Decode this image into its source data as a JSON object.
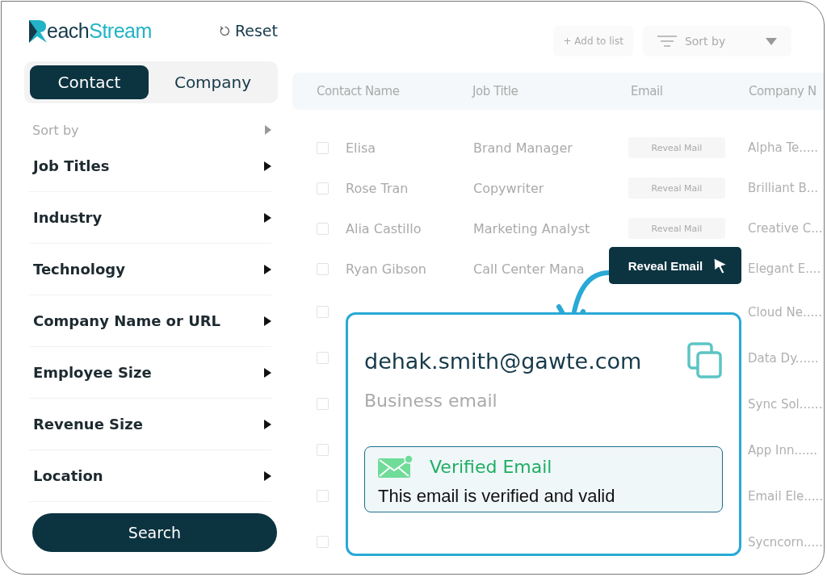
{
  "logo": {
    "parts": [
      {
        "text": "each",
        "color": "#163a4a"
      },
      {
        "text": "Stream",
        "color": "#22b3c6"
      }
    ]
  },
  "reset": {
    "label": "Reset"
  },
  "tabs": [
    {
      "label": "Contact",
      "selected": true
    },
    {
      "label": "Company",
      "selected": false
    }
  ],
  "sort_by": {
    "label": "Sort by"
  },
  "filters": [
    {
      "label": "Job Titles"
    },
    {
      "label": "Industry"
    },
    {
      "label": "Technology"
    },
    {
      "label": "Company Name or URL"
    },
    {
      "label": "Employee Size"
    },
    {
      "label": "Revenue Size"
    },
    {
      "label": "Location"
    }
  ],
  "search_button": {
    "label": "Search"
  },
  "toolbar": {
    "add_to_list": "+ Add to list",
    "sort_by": "Sort by"
  },
  "table": {
    "columns": [
      "Contact Name",
      "Job Title",
      "Email",
      "Company N"
    ],
    "rows": [
      {
        "checked": false,
        "name": "Elisa",
        "job_title": "Brand Manager",
        "email": "Reveal Mail",
        "company": "Alpha Te....."
      },
      {
        "checked": false,
        "name": "Rose Tran",
        "job_title": "Copywriter",
        "email": "Reveal Mail",
        "company": "Brilliant B..."
      },
      {
        "checked": false,
        "name": "Alia Castillo",
        "job_title": "Marketing Analyst",
        "email": "Reveal Mail",
        "company": "Creative C..."
      },
      {
        "checked": false,
        "name": "Ryan Gibson",
        "job_title": "Call Center Mana",
        "company": "Elegant E...."
      },
      {
        "checked": false,
        "company": "Cloud Ne....."
      },
      {
        "checked": false,
        "company": "Data Dy......"
      },
      {
        "checked": false,
        "company": "Sync Sol......"
      },
      {
        "checked": false,
        "company": "App Inn......"
      },
      {
        "checked": false,
        "company": "Email Ele......"
      },
      {
        "checked": false,
        "company": "Sycncorn......"
      }
    ]
  },
  "reveal_button": {
    "label": "Reveal Email"
  },
  "email_card": {
    "email": "dehak.smith@gawte.com",
    "type": "Business email",
    "verification": {
      "title": "Verified Email",
      "message": "This email is verified and valid"
    }
  }
}
